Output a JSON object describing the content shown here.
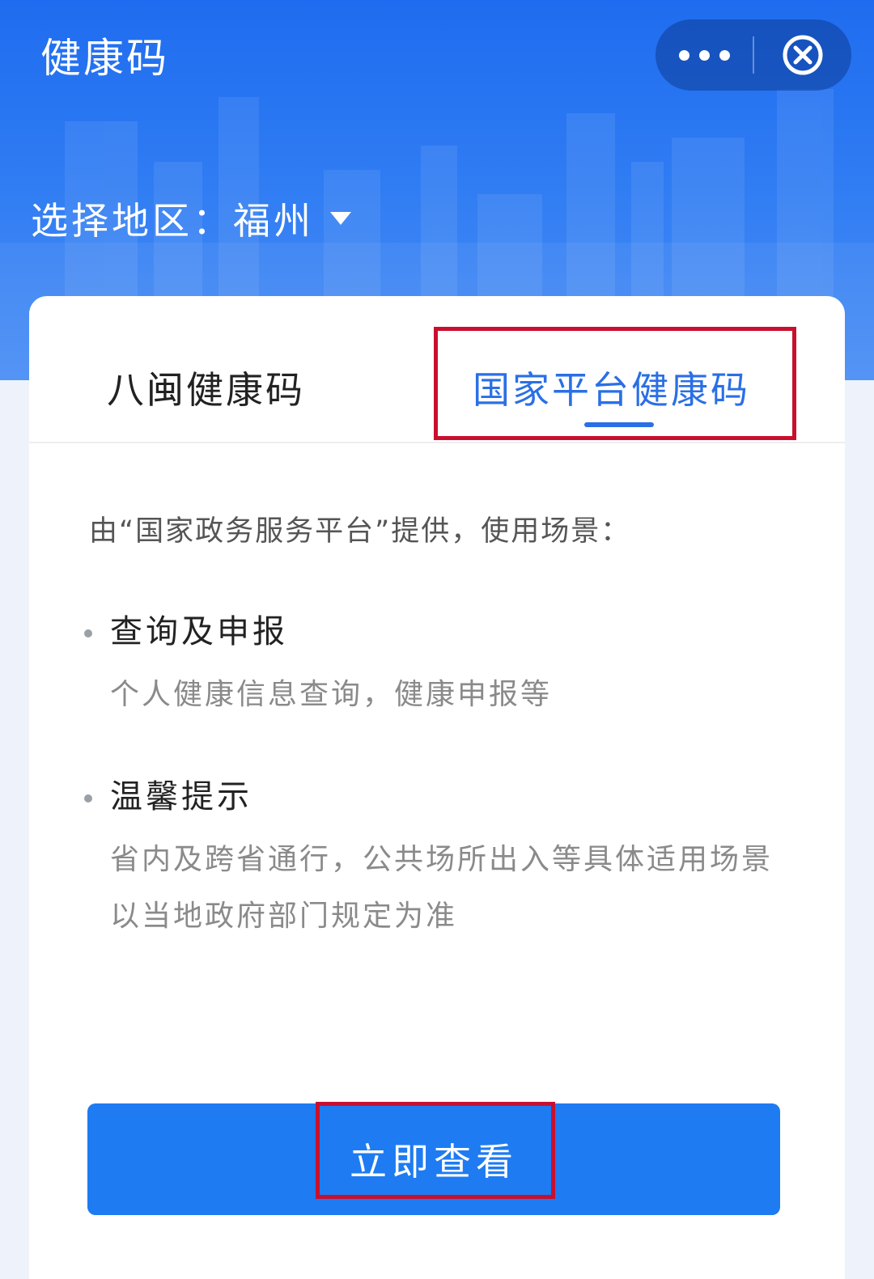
{
  "header": {
    "title": "健康码",
    "capsule": {
      "more_icon": "more-icon",
      "close_icon": "close-circle-icon"
    },
    "region": {
      "label": "选择地区：",
      "value": "福州",
      "dropdown_icon": "caret-down-icon"
    }
  },
  "tabs": [
    {
      "label": "八闽健康码",
      "active": false
    },
    {
      "label": "国家平台健康码",
      "active": true
    }
  ],
  "content": {
    "intro": "由“国家政务服务平台”提供，使用场景：",
    "bullets": [
      {
        "title": "查询及申报",
        "desc": "个人健康信息查询，健康申报等"
      },
      {
        "title": "温馨提示",
        "desc": "省内及跨省通行，公共场所出入等具体适用场景以当地政府部门规定为准"
      }
    ]
  },
  "action": {
    "label": "立即查看"
  },
  "colors": {
    "header_blue": "#1f6cf0",
    "active_tab": "#2a6fe6",
    "button_blue": "#1e7bf2",
    "highlight_red": "#c8102e"
  }
}
